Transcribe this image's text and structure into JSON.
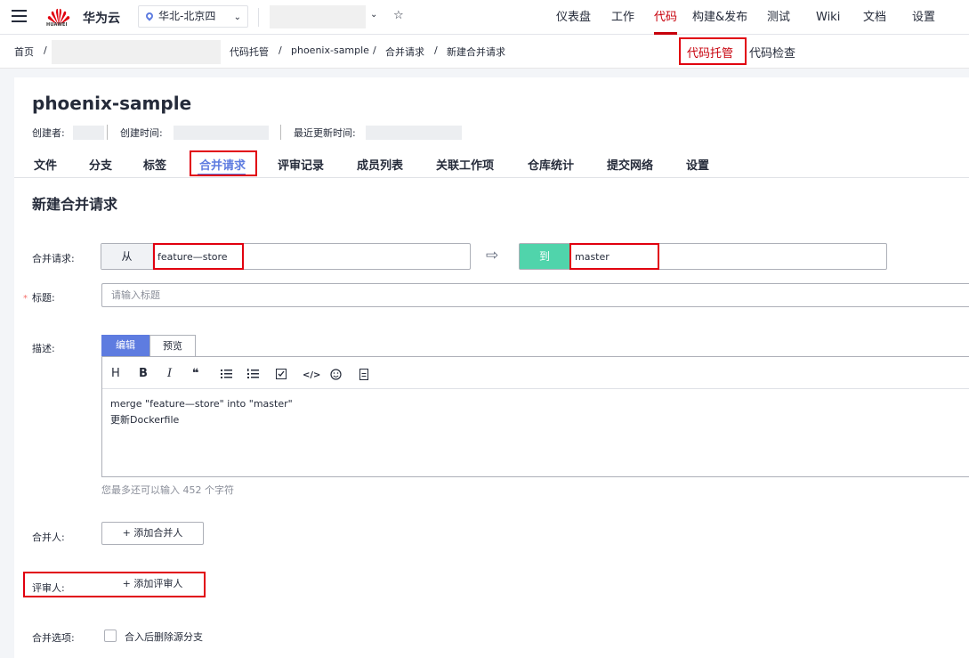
{
  "topbar": {
    "brand": "华为云",
    "logo_text": "HUAWEI",
    "region": "华北-北京四",
    "nav": [
      "仪表盘",
      "工作",
      "代码",
      "构建&发布",
      "测试",
      "Wiki",
      "文档",
      "设置"
    ],
    "active_nav": "代码",
    "accent_color": "#c7000b"
  },
  "breadcrumb": {
    "home": "首页",
    "sep": "/",
    "items": [
      "代码托管",
      "phoenix-sample",
      "合并请求",
      "新建合并请求"
    ],
    "right_links": [
      "代码托管",
      "代码检查"
    ]
  },
  "repo": {
    "name": "phoenix-sample",
    "creator_label": "创建者:",
    "created_label": "创建时间:",
    "updated_label": "最近更新时间:"
  },
  "tabs": [
    "文件",
    "分支",
    "标签",
    "合并请求",
    "评审记录",
    "成员列表",
    "关联工作项",
    "仓库统计",
    "提交网络",
    "设置"
  ],
  "active_tab": "合并请求",
  "form": {
    "section_title": "新建合并请求",
    "merge_label": "合并请求:",
    "from_label": "从",
    "source_branch": "feature—store",
    "to_label": "到",
    "target_branch": "master",
    "title_label": "标题:",
    "title_placeholder": "请输入标题",
    "desc_label": "描述:",
    "editor_tabs": {
      "edit": "编辑",
      "preview": "预览"
    },
    "toolbar": [
      "H",
      "B",
      "I",
      "❝",
      "bullet-list-icon",
      "ordered-list-icon",
      "checklist-icon",
      "code-icon",
      "emoji-icon",
      "file-icon"
    ],
    "description_lines": [
      "merge \"feature—store\" into \"master\"",
      "更新Dockerfile"
    ],
    "char_hint": "您最多还可以输入 452 个字符",
    "merger_label": "合并人:",
    "add_merger": "+ 添加合并人",
    "reviewer_label": "评审人:",
    "add_reviewer": "+ 添加评审人",
    "options_label": "合并选项:",
    "delete_source_branch": "合入后删除源分支",
    "delete_source_checked": false
  }
}
